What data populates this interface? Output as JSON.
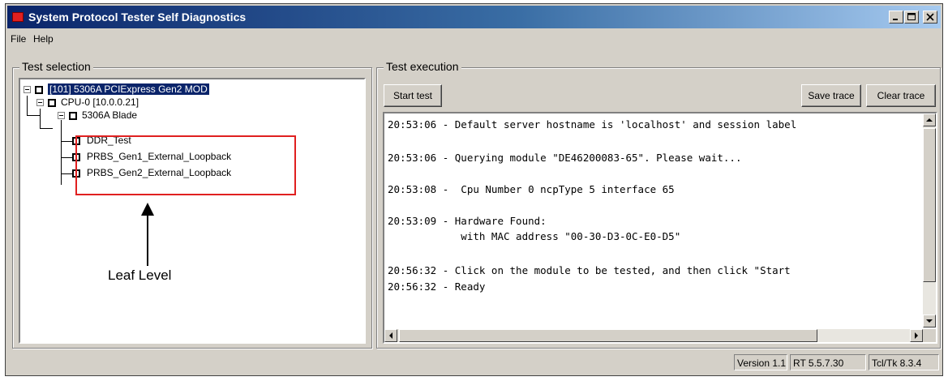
{
  "window": {
    "title": "System Protocol Tester Self Diagnostics"
  },
  "menu": {
    "items": [
      "File",
      "Help"
    ]
  },
  "test_selection": {
    "label": "Test selection",
    "tree": [
      {
        "label": "[101] 5306A PCIExpress Gen2 MOD",
        "selected": true
      },
      {
        "label": "CPU-0 [10.0.0.21]"
      },
      {
        "label": "5306A Blade"
      },
      {
        "label": "DDR_Test"
      },
      {
        "label": "PRBS_Gen1_External_Loopback"
      },
      {
        "label": "PRBS_Gen2_External_Loopback"
      }
    ]
  },
  "test_execution": {
    "label": "Test execution",
    "start_label": "Start test",
    "save_label": "Save trace",
    "clear_label": "Clear trace",
    "trace_lines": [
      "20:53:06 - Default server hostname is 'localhost' and session label",
      "20:53:06 - Querying module \"DE46200083-65\". Please wait...",
      "20:53:08 -  Cpu Number 0 ncpType 5 interface 65",
      "20:53:09 - Hardware Found:",
      "            with MAC address \"00-30-D3-0C-E0-D5\"",
      "20:56:32 - Click on the module to be tested, and then click \"Start",
      "20:56:32 - Ready"
    ]
  },
  "status": {
    "version": "Version 1.1",
    "rt": "RT 5.5.7.30",
    "tcl": "Tcl/Tk 8.3.4"
  },
  "annotation": {
    "label": "Leaf Level",
    "color": "#e02020"
  },
  "colors": {
    "title_start": "#0a246a",
    "title_end": "#a6caf0",
    "selection": "#0a246a",
    "face": "#d4d0c8"
  }
}
